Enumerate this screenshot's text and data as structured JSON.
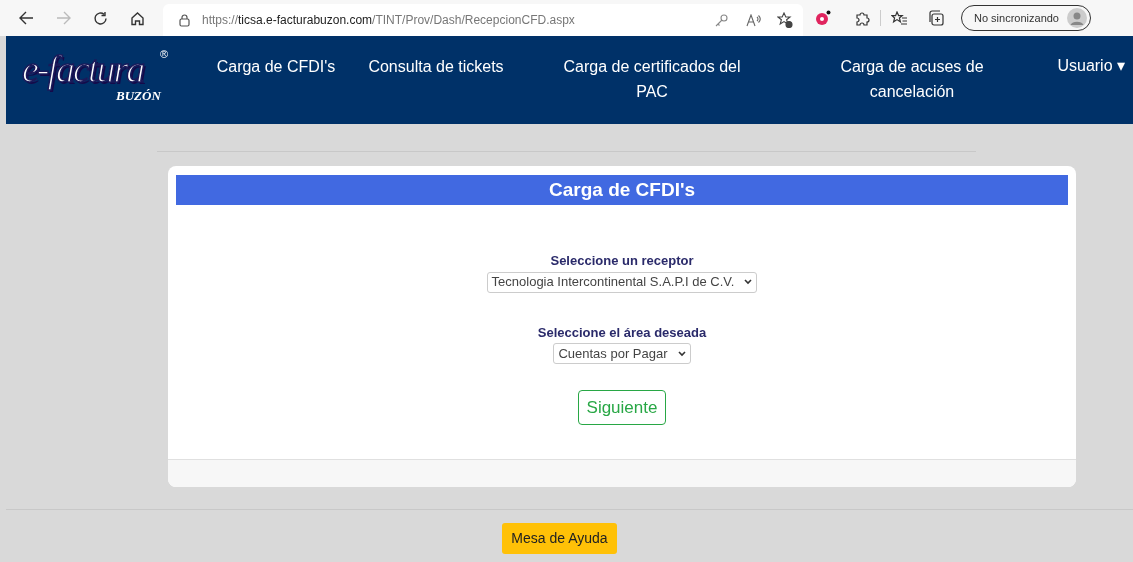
{
  "browser": {
    "url_scheme": "https://",
    "url_host": "ticsa.e-facturabuzon.com",
    "url_path": "/TINT/Prov/Dash/RecepcionCFD.aspx",
    "profile_label": "No sincronizando"
  },
  "navbar": {
    "logo": {
      "main": "e-factura",
      "registered": "®",
      "sub": "BUZÓN"
    },
    "items": [
      {
        "label": "Carga de CFDI's"
      },
      {
        "label": "Consulta de tickets"
      },
      {
        "label": "Carga de certificados del PAC"
      },
      {
        "label": "Carga de acuses de cancelación"
      }
    ],
    "user_menu": {
      "label": "Usuario",
      "caret": "▾"
    }
  },
  "card": {
    "title": "Carga de CFDI's",
    "fields": [
      {
        "label": "Seleccione un receptor",
        "value": "Tecnologia Intercontinental S.A.P.I de C.V."
      },
      {
        "label": "Seleccione el área deseada",
        "value": "Cuentas por Pagar"
      }
    ],
    "button": "Siguiente"
  },
  "footer": {
    "help_button": "Mesa de Ayuda"
  }
}
